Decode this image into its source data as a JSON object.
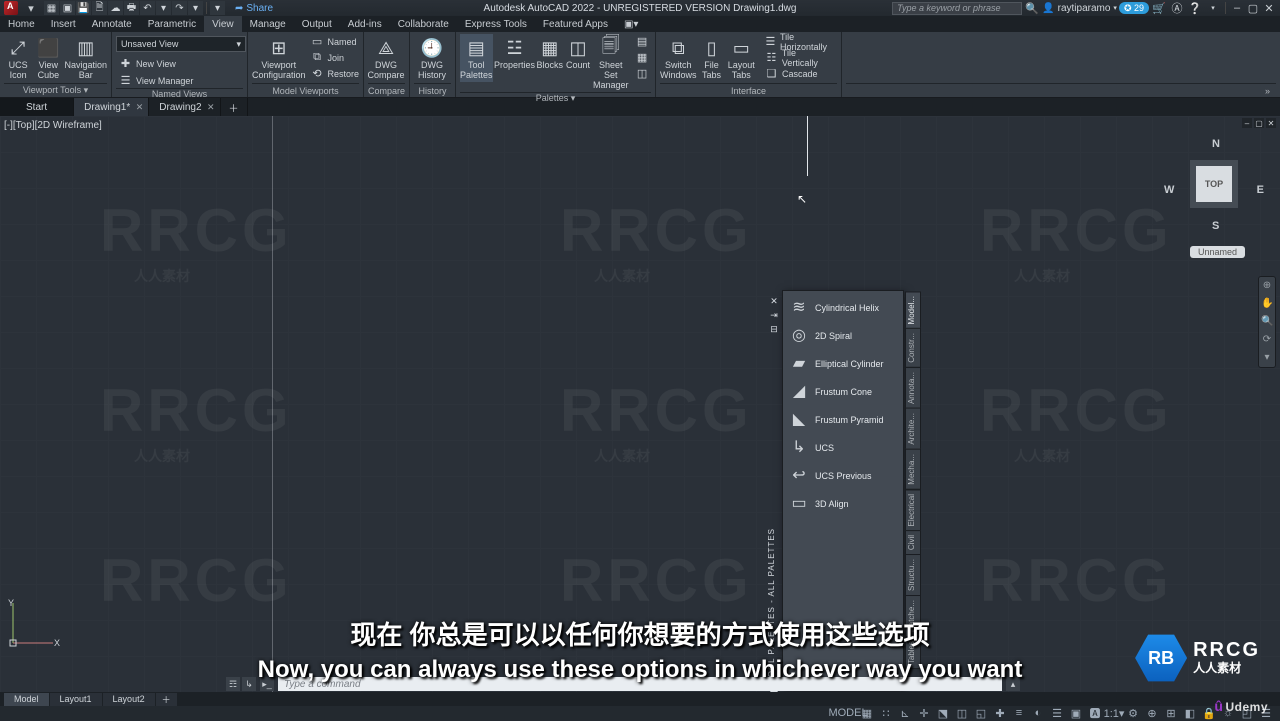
{
  "app": {
    "title": "Autodesk AutoCAD 2022 - UNREGISTERED VERSION    Drawing1.dwg",
    "share": "Share"
  },
  "qat": [
    "▦",
    "▤",
    "🖶",
    "↶",
    "↷",
    "▾",
    "▦",
    "▤",
    "▾"
  ],
  "search": {
    "placeholder": "Type a keyword or phrase"
  },
  "user": {
    "name": "raytiparamo",
    "badge": "✪ 29"
  },
  "menu_tabs": [
    "Home",
    "Insert",
    "Annotate",
    "Parametric",
    "View",
    "Manage",
    "Output",
    "Add-ins",
    "Collaborate",
    "Express Tools",
    "Featured Apps"
  ],
  "menu_active": "View",
  "ribbon": {
    "viewport_tools": {
      "title": "Viewport Tools  ▾",
      "ucs": "UCS Icon",
      "cube": "View Cube",
      "nav": "Navigation Bar"
    },
    "named_views": {
      "title": "Named Views",
      "combo": "Unsaved View",
      "new": "New View",
      "mgr": "View Manager"
    },
    "model_viewports": {
      "title": "Model Viewports",
      "vpconf": "Viewport Configuration",
      "named": "Named",
      "join": "Join",
      "restore": "Restore"
    },
    "compare": {
      "title": "Compare",
      "dwg": "DWG Compare"
    },
    "history": {
      "title": "History",
      "dwg": "DWG History"
    },
    "palettes": {
      "title": "Palettes  ▾",
      "tool": "Tool Palettes",
      "prop": "Properties",
      "blocks": "Blocks",
      "count": "Count",
      "sheet": "Sheet Set Manager"
    },
    "interface": {
      "title": "Interface",
      "switch": "Switch Windows",
      "file": "File Tabs",
      "layout": "Layout Tabs",
      "tile_h": "Tile Horizontally",
      "tile_v": "Tile Vertically",
      "cascade": "Cascade"
    }
  },
  "file_tabs": {
    "start": "Start",
    "tabs": [
      {
        "label": "Drawing1*"
      },
      {
        "label": "Drawing2"
      }
    ]
  },
  "view_label": "[-][Top][2D Wireframe]",
  "viewcube": {
    "n": "N",
    "s": "S",
    "e": "E",
    "w": "W",
    "face": "TOP",
    "tag": "Unnamed"
  },
  "palette": {
    "title": "TOOL PALETTES - ALL PALETTES",
    "items": [
      {
        "icon": "≋",
        "label": "Cylindrical Helix"
      },
      {
        "icon": "◎",
        "label": "2D Spiral"
      },
      {
        "icon": "▰",
        "label": "Elliptical Cylinder"
      },
      {
        "icon": "◢",
        "label": "Frustum Cone"
      },
      {
        "icon": "◣",
        "label": "Frustum Pyramid"
      },
      {
        "icon": "↳",
        "label": "UCS"
      },
      {
        "icon": "↩",
        "label": "UCS Previous"
      },
      {
        "icon": "▭",
        "label": "3D Align"
      }
    ],
    "tabs": [
      "Model...",
      "Constr...",
      "Annota...",
      "Archite...",
      "Mecha...",
      "Electrical",
      "Civil",
      "Structu...",
      "Hatche...",
      "Tables"
    ]
  },
  "cmd": {
    "placeholder": "Type a command"
  },
  "bottom_tabs": [
    "Model",
    "Layout1",
    "Layout2"
  ],
  "subs": {
    "cn": "现在 你总是可以以任何你想要的方式使用这些选项",
    "en": "Now, you can always use these options in whichever way you want"
  },
  "brand": {
    "logo": "RB",
    "name": "RRCG",
    "sub": "人人素材"
  },
  "udemy": "Udemy"
}
